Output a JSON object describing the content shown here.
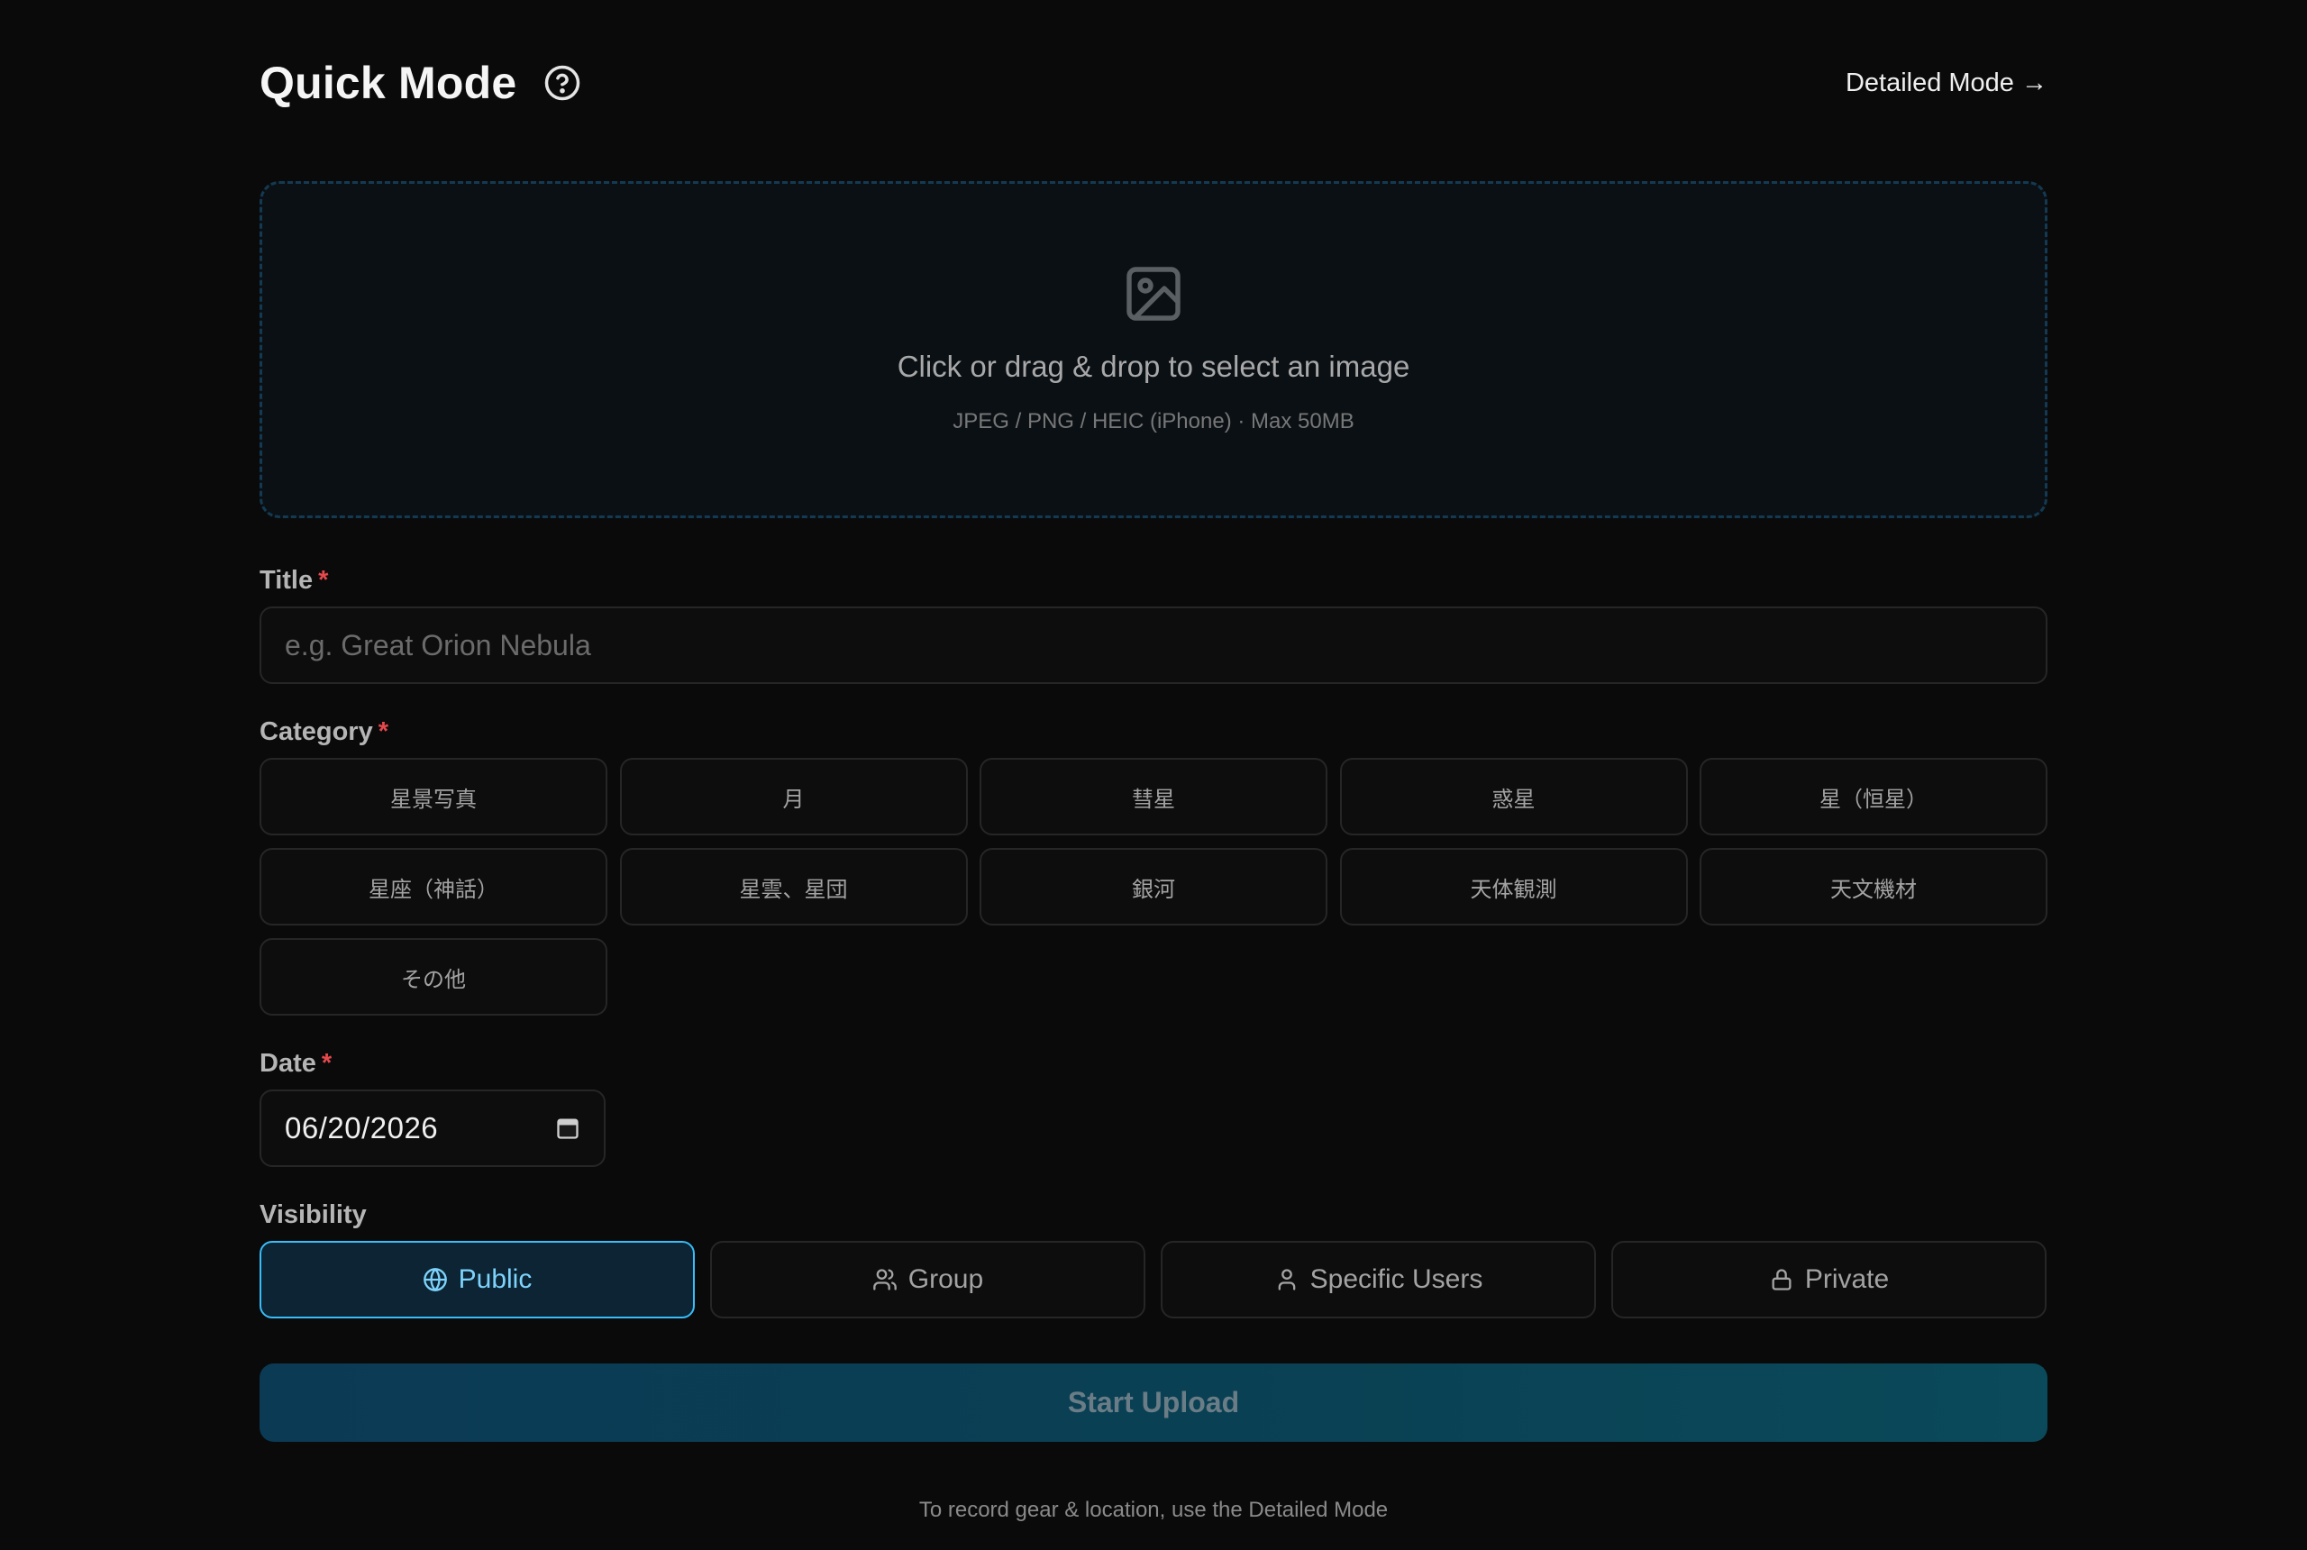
{
  "header": {
    "title": "Quick Mode",
    "help_icon": "help-circle-icon",
    "detailed_link": "Detailed Mode →"
  },
  "dropzone": {
    "icon": "image-icon",
    "text": "Click or drag & drop to select an image",
    "hint": "JPEG / PNG / HEIC (iPhone) · Max 50MB"
  },
  "title_field": {
    "label": "Title",
    "required_mark": "*",
    "placeholder": "e.g. Great Orion Nebula",
    "value": ""
  },
  "category": {
    "label": "Category",
    "required_mark": "*",
    "options": [
      "星景写真",
      "月",
      "彗星",
      "惑星",
      "星（恒星）",
      "星座（神話）",
      "星雲、星団",
      "銀河",
      "天体観測",
      "天文機材",
      "その他"
    ]
  },
  "date": {
    "label": "Date",
    "required_mark": "*",
    "value": "06/20/2026",
    "icon": "calendar-icon"
  },
  "visibility": {
    "label": "Visibility",
    "selected": "Public",
    "options": [
      {
        "label": "Public",
        "icon": "globe-icon"
      },
      {
        "label": "Group",
        "icon": "users-icon"
      },
      {
        "label": "Specific Users",
        "icon": "user-icon"
      },
      {
        "label": "Private",
        "icon": "lock-icon"
      }
    ]
  },
  "actions": {
    "upload_label": "Start Upload"
  },
  "footer": {
    "note": "To record gear & location, use the Detailed Mode"
  },
  "colors": {
    "background": "#0a0a0a",
    "accent": "#38bdf8",
    "required": "#e5484d"
  }
}
